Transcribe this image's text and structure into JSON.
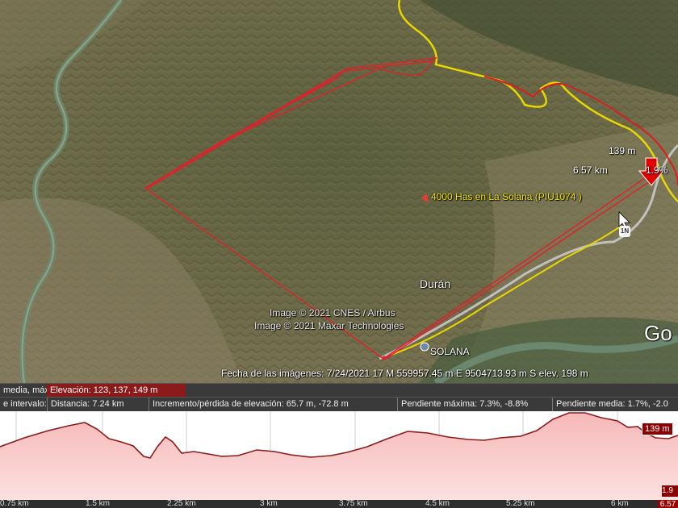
{
  "map": {
    "placemark_label": "4000 Has en La Solana (PIU1074 )",
    "towns": {
      "duran": "Durán",
      "solana": "SOLANA"
    },
    "imagery_credits": [
      "Image © 2021 CNES / Airbus",
      "Image © 2021 Maxar Technologies"
    ],
    "status_bar": "Fecha de las imágenes: 7/24/2021     17 M 559957.45 m E 9504713.93 m S   elev.   198 m",
    "logo_text": "Go",
    "road_shield": "1N",
    "cursor_readout": {
      "elevation": "139 m",
      "distance": "6.57 km",
      "slope": "1.9%"
    },
    "colors": {
      "boundary": "#e0202a",
      "route_yellow": "#e8d800",
      "route_red": "#d81e1e",
      "placemark": "#e53b3b"
    }
  },
  "elevation_profile": {
    "row1": {
      "label": "media, máx.",
      "elevation": "Elevación: 123, 137, 149 m"
    },
    "row2": {
      "label": "e intervalo:",
      "distance": "Distancia: 7.24 km",
      "gain_loss": "Incremento/pérdida de elevación: 65.7 m, -72.8 m",
      "max_slope": "Pendiente máxima: 7.3%, -8.8%",
      "avg_slope": "Pendiente media: 1.7%, -2.0"
    },
    "max_badge": "139 m",
    "slope_badge": "1.9",
    "end_badge": "6.57",
    "x_ticks": [
      "0.75 km",
      "1.5 km",
      "2.25 km",
      "3 km",
      "3.75 km",
      "4.5 km",
      "5.25 km",
      "6 km"
    ]
  }
}
